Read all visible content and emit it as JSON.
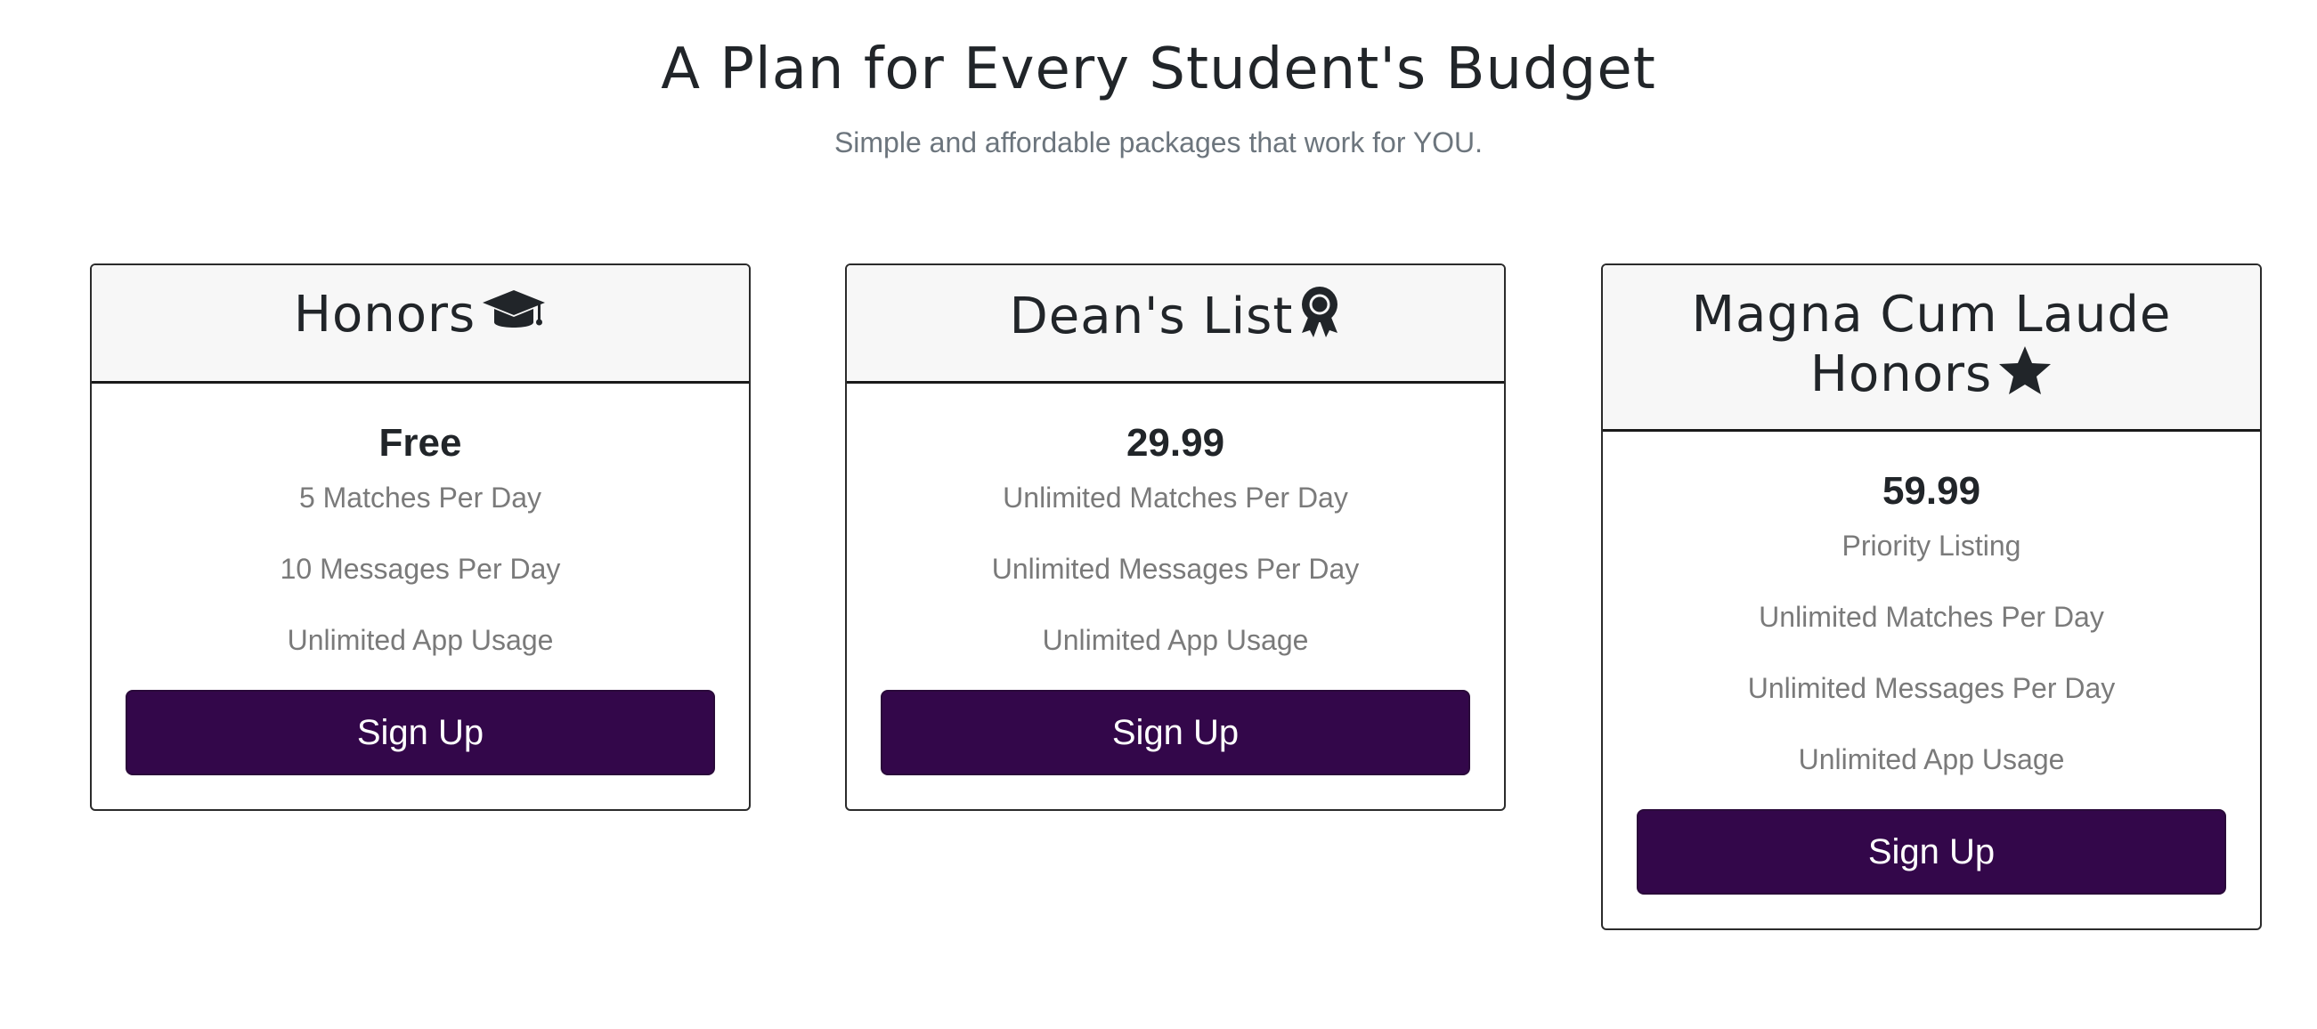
{
  "hero": {
    "title": "A Plan for Every Student's Budget",
    "subtitle": "Simple and affordable packages that work for YOU."
  },
  "plans": [
    {
      "name": "Honors",
      "icon": "graduation-cap-icon",
      "price": "Free",
      "features": [
        "5 Matches Per Day",
        "10 Messages Per Day",
        "Unlimited App Usage"
      ],
      "cta": "Sign Up"
    },
    {
      "name": "Dean's List",
      "icon": "award-ribbon-icon",
      "price": "29.99",
      "features": [
        "Unlimited Matches Per Day",
        "Unlimited Messages Per Day",
        "Unlimited App Usage"
      ],
      "cta": "Sign Up"
    },
    {
      "name": "Magna Cum Laude Honors",
      "icon": "star-icon",
      "price": "59.99",
      "features": [
        "Priority Listing",
        "Unlimited Matches Per Day",
        "Unlimited Messages Per Day",
        "Unlimited App Usage"
      ],
      "cta": "Sign Up"
    }
  ],
  "colors": {
    "button_background": "#33074a",
    "header_background": "#f7f7f7",
    "feature_text": "#7a7a7a",
    "subtitle_text": "#6c757d"
  }
}
